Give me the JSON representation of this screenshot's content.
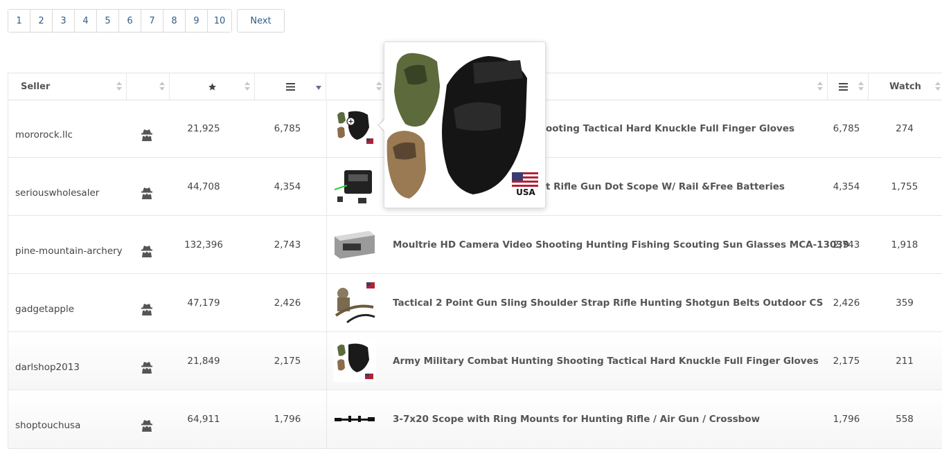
{
  "pagination": {
    "pages": [
      "1",
      "2",
      "3",
      "4",
      "5",
      "6",
      "7",
      "8",
      "9",
      "10"
    ],
    "next_label": "Next"
  },
  "table": {
    "headers": {
      "seller": "Seller",
      "watch": "Watch"
    },
    "rows": [
      {
        "seller": "mororock.llc",
        "rating": "21,925",
        "sold": "6,785",
        "title": "Army Military Combat Hunting Shooting Tactical Hard Knuckle Full Finger Gloves",
        "visible_title": "ooting Tactical Hard Knuckle Full Finger Gloves",
        "sold2": "6,785",
        "watch": "274",
        "thumb": "gloves"
      },
      {
        "seller": "seriouswholesaler",
        "rating": "44,708",
        "sold": "4,354",
        "title": "Tactical Red Green Laser Sight Rifle Gun Dot Scope W/ Rail &Free Batteries",
        "visible_title": "t Rifle Gun Dot Scope W/ Rail &Free Batteries",
        "sold2": "4,354",
        "watch": "1,755",
        "thumb": "laser"
      },
      {
        "seller": "pine-mountain-archery",
        "rating": "132,396",
        "sold": "2,743",
        "title": "Moultrie HD Camera Video Shooting Hunting Fishing Scouting Sun Glasses MCA-13039",
        "visible_title": "Moultrie HD Camera Video Shooting Hunting Fishing Scouting Sun Glasses MCA-13039",
        "sold2": "2,743",
        "watch": "1,918",
        "thumb": "box"
      },
      {
        "seller": "gadgetapple",
        "rating": "47,179",
        "sold": "2,426",
        "title": "Tactical 2 Point Gun Sling Shoulder Strap Rifle Hunting Shotgun Belts Outdoor CS",
        "visible_title": "Tactical 2 Point Gun Sling Shoulder Strap Rifle Hunting Shotgun Belts Outdoor CS",
        "sold2": "2,426",
        "watch": "359",
        "thumb": "sling"
      },
      {
        "seller": "darlshop2013",
        "rating": "21,849",
        "sold": "2,175",
        "title": "Army Military Combat Hunting Shooting Tactical Hard Knuckle Full Finger Gloves",
        "visible_title": "Army Military Combat Hunting Shooting Tactical Hard Knuckle Full Finger Gloves",
        "sold2": "2,175",
        "watch": "211",
        "thumb": "gloves"
      },
      {
        "seller": "shoptouchusa",
        "rating": "64,911",
        "sold": "1,796",
        "title": "3-7x20 Scope with Ring Mounts for Hunting Rifle / Air Gun / Crossbow",
        "visible_title": "3-7x20 Scope with Ring Mounts for Hunting Rifle / Air Gun / Crossbow",
        "sold2": "1,796",
        "watch": "558",
        "thumb": "scope"
      }
    ]
  },
  "popup": {
    "flag_text": "USA"
  },
  "icons": {
    "seller_type": "spy-icon",
    "rating_header": "star-icon",
    "sold_header": "list-icon",
    "sold2_header": "list-icon"
  }
}
